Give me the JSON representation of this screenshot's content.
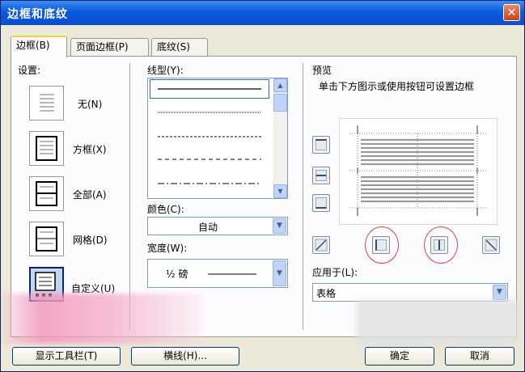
{
  "window": {
    "title": "边框和底纹"
  },
  "tabs": [
    {
      "label": "边框(B)",
      "active": true
    },
    {
      "label": "页面边框(P)",
      "active": false
    },
    {
      "label": "底纹(S)",
      "active": false
    }
  ],
  "settings": {
    "heading": "设置:",
    "items": [
      {
        "label": "无(N)",
        "icon": "setting-none-icon"
      },
      {
        "label": "方框(X)",
        "icon": "setting-box-icon"
      },
      {
        "label": "全部(A)",
        "icon": "setting-all-icon"
      },
      {
        "label": "网格(D)",
        "icon": "setting-grid-icon"
      },
      {
        "label": "自定义(U)",
        "icon": "setting-custom-icon",
        "selected": true
      }
    ]
  },
  "style": {
    "heading": "线型(Y):",
    "lines": [
      "solid",
      "dotted",
      "dashed-small",
      "dashed",
      "dash-dot"
    ]
  },
  "color": {
    "label": "颜色(C):",
    "value": "自动"
  },
  "width": {
    "label": "宽度(W):",
    "value": "½ 磅"
  },
  "preview": {
    "heading": "预览",
    "instruction": "单击下方图示或使用按钮可设置边框"
  },
  "apply_to": {
    "label": "应用于(L):",
    "value": "表格"
  },
  "buttons": {
    "toolbar": "显示工具栏(T)",
    "horizontal_line": "横线(H)...",
    "ok": "确定",
    "cancel": "取消"
  },
  "colors": {
    "titlebar": "#0a5adc",
    "dialog_bg": "#ece9d8",
    "highlight_ring": "#e0403a",
    "tab_accent": "#ffc73c"
  }
}
